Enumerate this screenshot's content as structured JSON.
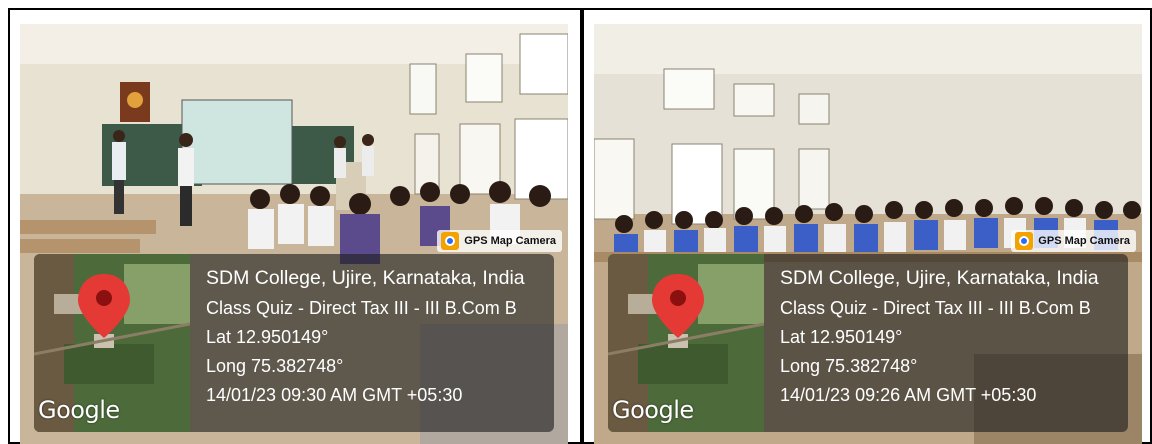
{
  "panels": [
    {
      "badge": "GPS Map Camera",
      "map_label": "Google",
      "location": "SDM College, Ujire, Karnataka, India",
      "event": "Class Quiz - Direct Tax III - III B.Com B",
      "lat": "Lat 12.950149°",
      "long": "Long 75.382748°",
      "timestamp": "14/01/23 09:30 AM GMT +05:30"
    },
    {
      "badge": "GPS Map Camera",
      "map_label": "Google",
      "location": "SDM College, Ujire, Karnataka, India",
      "event": "Class Quiz - Direct Tax III - III B.Com B",
      "lat": "Lat 12.950149°",
      "long": "Long 75.382748°",
      "timestamp": "14/01/23 09:26 AM GMT +05:30"
    }
  ],
  "colors": {
    "pin": "#e53935",
    "overlay": "#1e1e1e",
    "uniform": "#3b5fc6"
  }
}
